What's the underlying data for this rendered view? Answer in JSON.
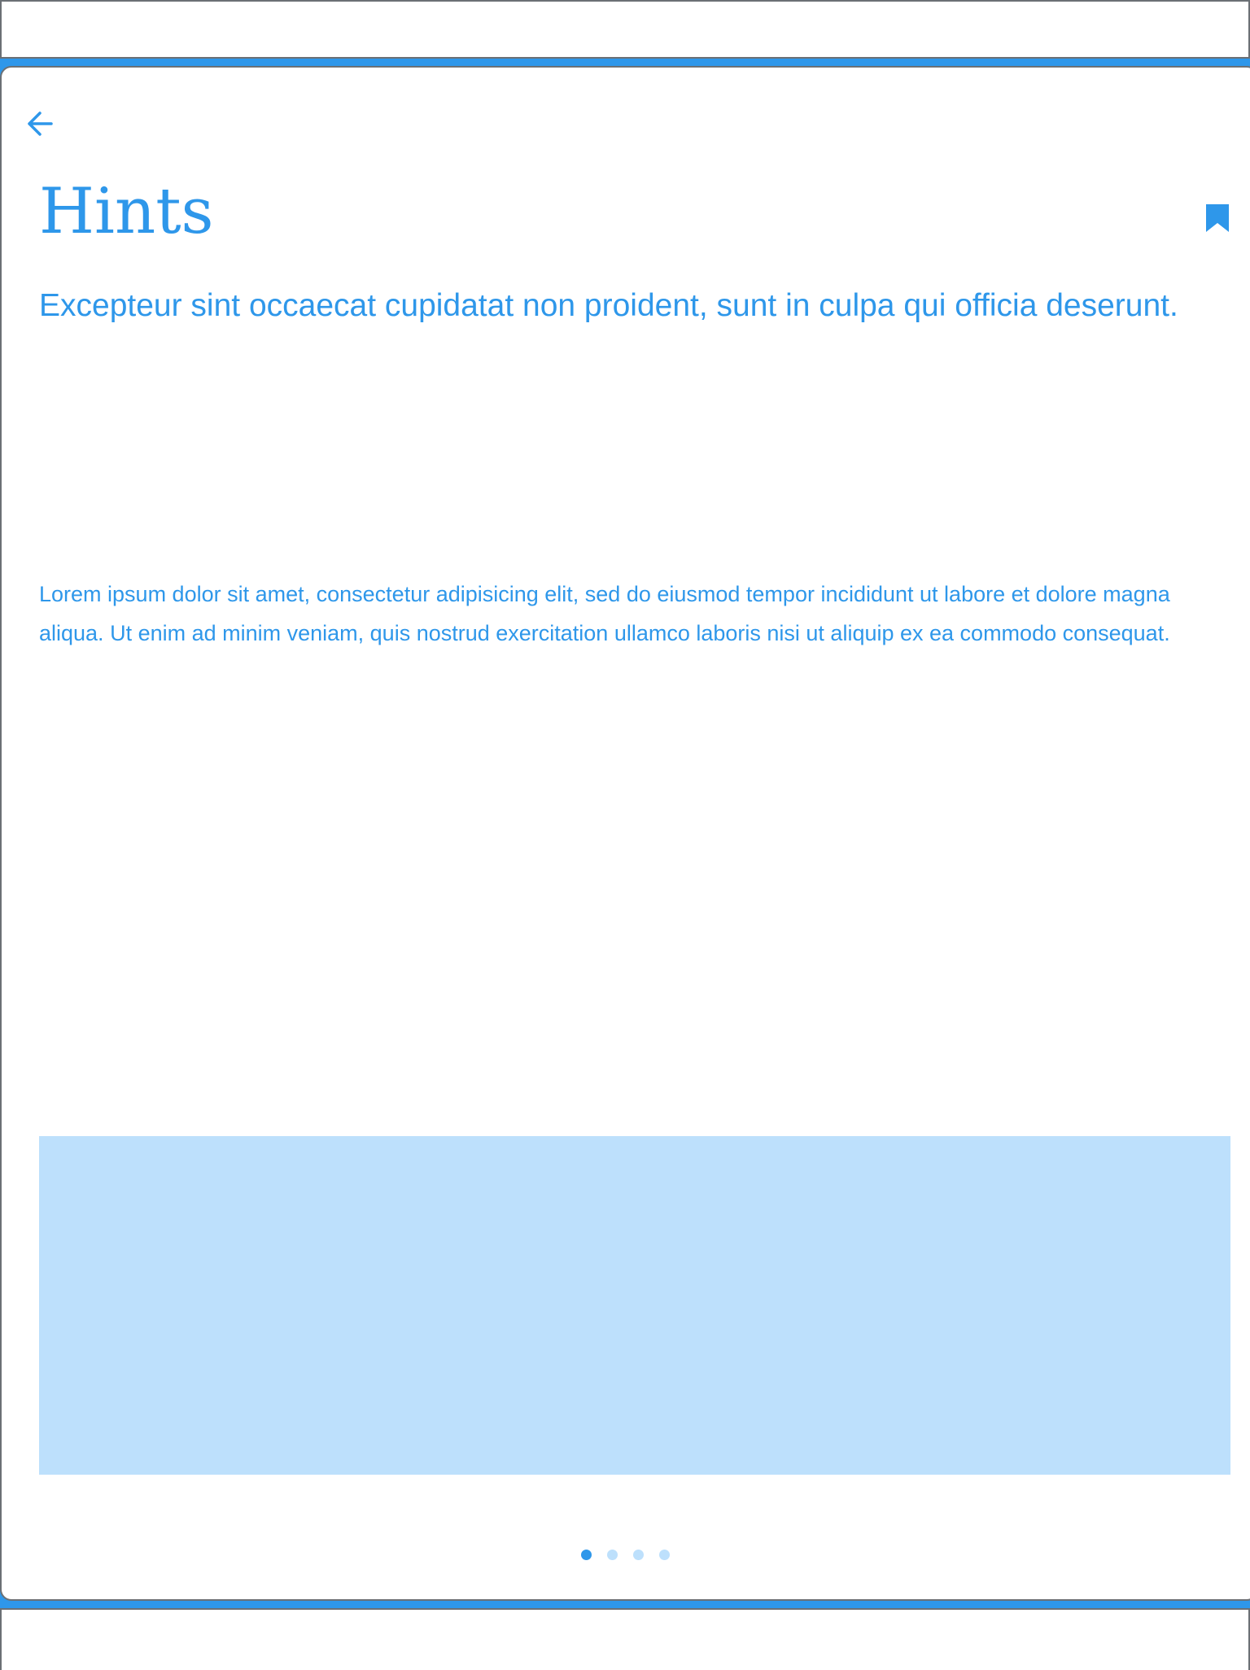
{
  "colors": {
    "accent": "#2e97ea",
    "accent_light": "#bde0fc",
    "frame": "#6b7075",
    "background": "#ffffff"
  },
  "header": {
    "back_icon": "arrow-left-icon",
    "bookmark_icon": "bookmark-icon"
  },
  "content": {
    "title": "Hints",
    "subtitle": "Excepteur sint occaecat cupidatat non proident, sunt in culpa qui officia deserunt.",
    "body": "Lorem ipsum dolor sit amet, consectetur adipisicing elit, sed do eiusmod tempor incididunt ut labore et dolore magna aliqua. Ut enim ad minim veniam, quis nostrud exercitation ullamco laboris nisi ut aliquip ex ea commodo consequat."
  },
  "pagination": {
    "total": 4,
    "active_index": 0
  }
}
